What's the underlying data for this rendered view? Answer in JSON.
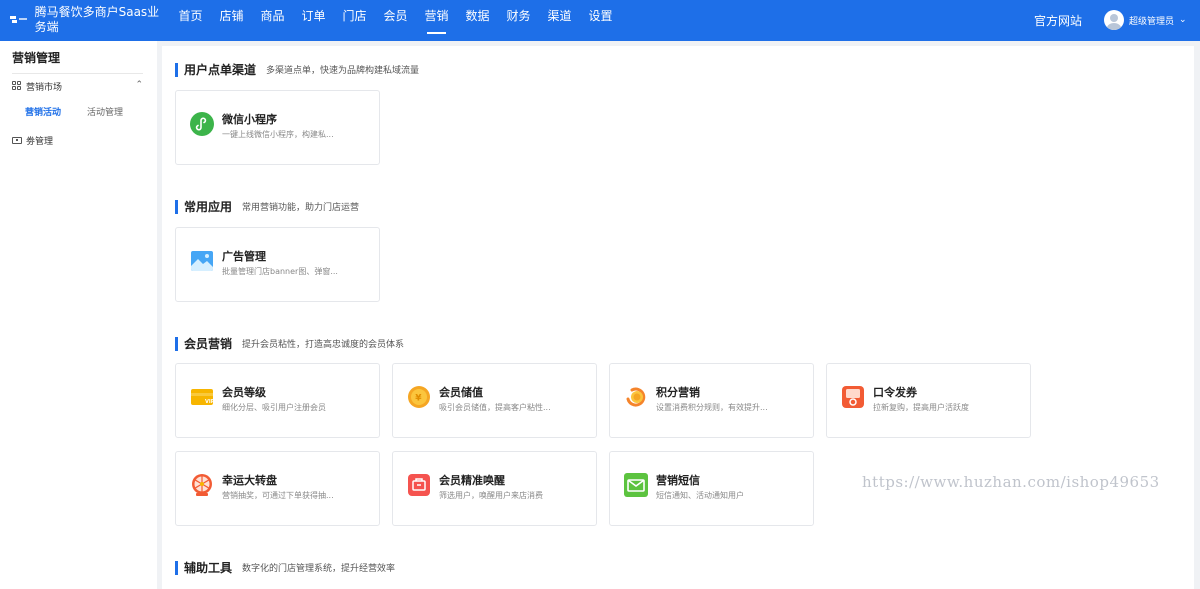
{
  "header": {
    "brand": "腾马餐饮多商户Saas业务端",
    "nav": [
      "首页",
      "店铺",
      "商品",
      "订单",
      "门店",
      "会员",
      "营销",
      "数据",
      "财务",
      "渠道",
      "设置"
    ],
    "active_nav": "营销",
    "site_link": "官方网站",
    "user_name": "超级管理员",
    "accent": "#1e6fe8"
  },
  "sidebar": {
    "title": "营销管理",
    "groups": [
      {
        "label": "营销市场",
        "icon": "grid-icon",
        "expanded": true
      },
      {
        "label": "劵管理",
        "icon": "ticket-icon"
      }
    ],
    "sub_items": [
      {
        "label": "营销活动",
        "active": true
      },
      {
        "label": "活动管理",
        "active": false
      }
    ]
  },
  "sections": [
    {
      "title": "用户点单渠道",
      "desc": "多渠道点单，快速为品牌构建私域流量",
      "cards": [
        {
          "name": "微信小程序",
          "desc": "一键上线微信小程序，构建私...",
          "icon": "wechat-miniprogram-icon"
        }
      ]
    },
    {
      "title": "常用应用",
      "desc": "常用营销功能，助力门店运营",
      "cards": [
        {
          "name": "广告管理",
          "desc": "批量管理门店banner图、弹窗...",
          "icon": "advertisement-icon"
        }
      ]
    },
    {
      "title": "会员营销",
      "desc": "提升会员粘性，打造高忠诚度的会员体系",
      "cards": [
        {
          "name": "会员等级",
          "desc": "细化分层、吸引用户注册会员",
          "icon": "vip-card-icon"
        },
        {
          "name": "会员储值",
          "desc": "吸引会员储值，提高客户粘性...",
          "icon": "coin-icon"
        },
        {
          "name": "积分营销",
          "desc": "设置消费积分规则，有效提升...",
          "icon": "points-icon"
        },
        {
          "name": "口令发券",
          "desc": "拉新复购，提高用户活跃度",
          "icon": "coupon-password-icon"
        },
        {
          "name": "幸运大转盘",
          "desc": "营销抽奖，可通过下单获得抽...",
          "icon": "lucky-wheel-icon"
        },
        {
          "name": "会员精准唤醒",
          "desc": "筛选用户，唤醒用户来店消费",
          "icon": "member-wakeup-icon"
        },
        {
          "name": "营销短信",
          "desc": "短信通知、活动通知用户",
          "icon": "sms-icon"
        }
      ]
    },
    {
      "title": "辅助工具",
      "desc": "数字化的门店管理系统，提升经营效率",
      "cards": []
    }
  ],
  "watermark": "https://www.huzhan.com/ishop49653"
}
